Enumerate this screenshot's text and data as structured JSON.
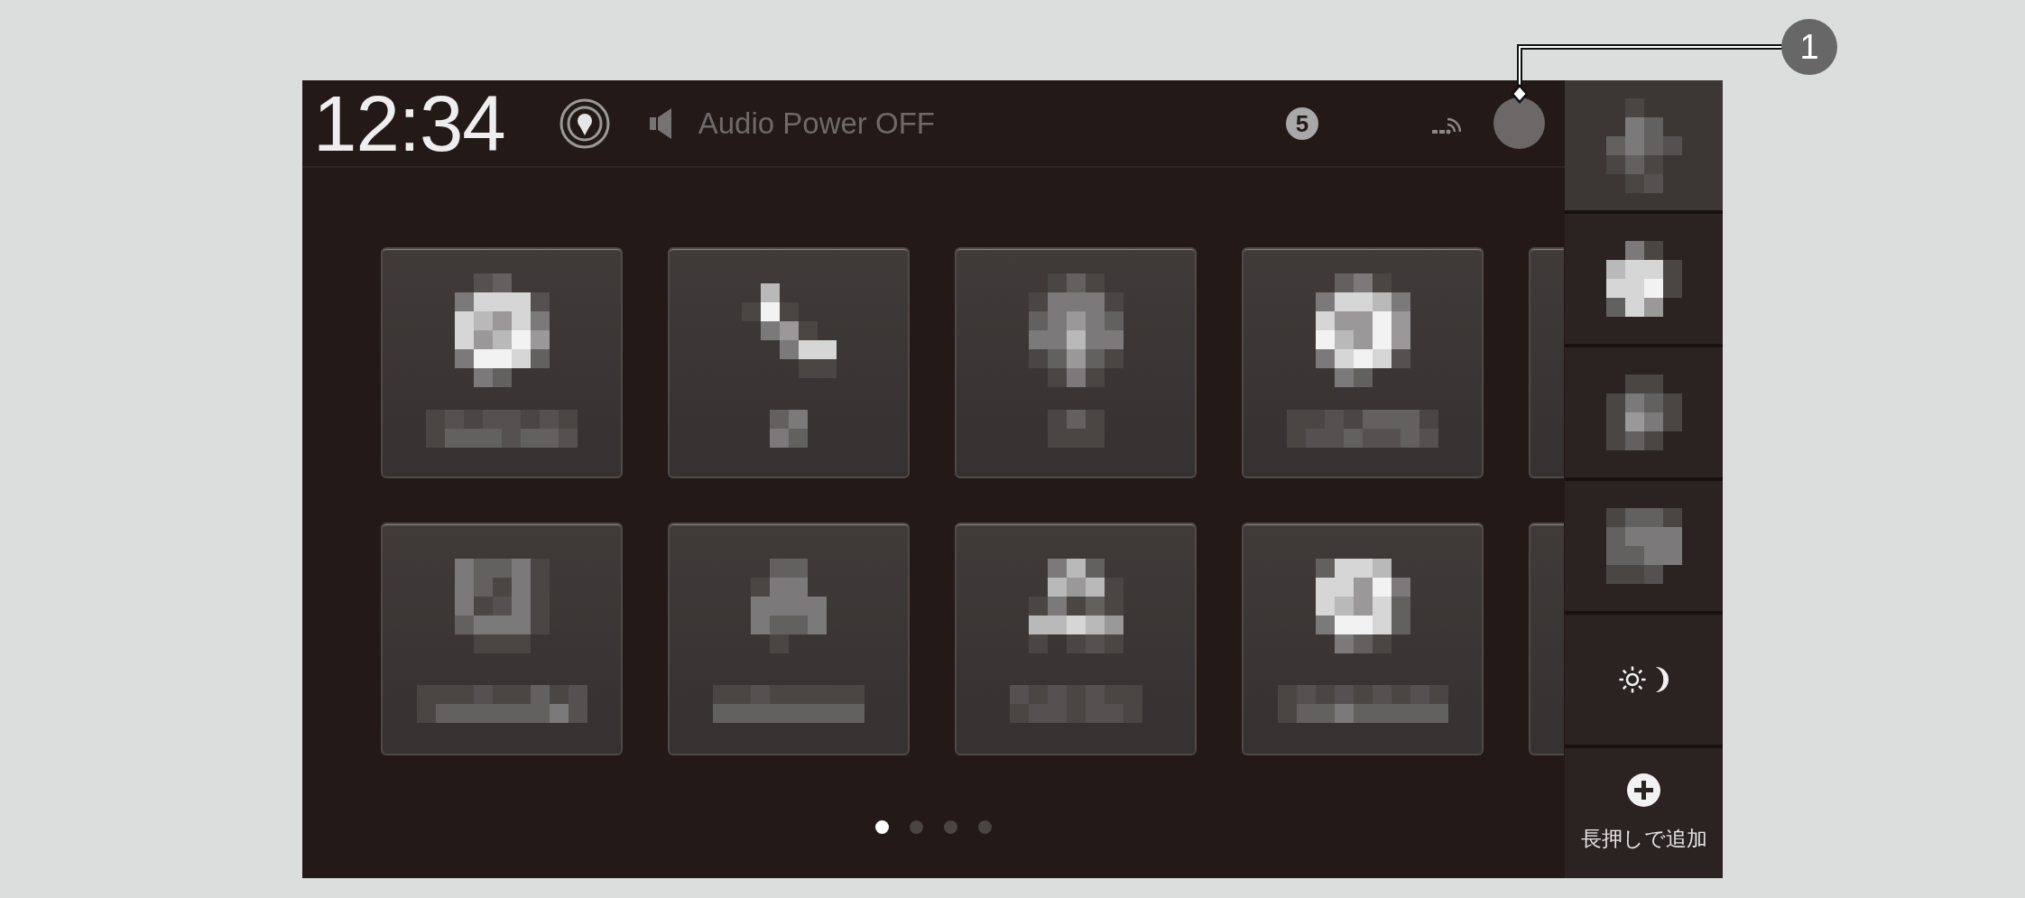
{
  "status_bar": {
    "clock": "12:34",
    "audio_status": "Audio Power OFF",
    "badge": "5"
  },
  "callout": {
    "number": "1"
  },
  "tiles": [
    {
      "kind": "disc"
    },
    {
      "kind": "handset"
    },
    {
      "kind": "pin"
    },
    {
      "kind": "ring"
    },
    {
      "kind": "partial"
    },
    {
      "kind": "square"
    },
    {
      "kind": "triangle"
    },
    {
      "kind": "nodes"
    },
    {
      "kind": "sphere"
    },
    {
      "kind": "partial"
    }
  ],
  "pages": [
    {
      "selected": true
    },
    {
      "selected": false
    },
    {
      "selected": false
    },
    {
      "selected": false
    }
  ],
  "sidebar": {
    "items": [
      {
        "kind": "mosaic_cross",
        "selected": true
      },
      {
        "kind": "mosaic_bright",
        "selected": false
      },
      {
        "kind": "mosaic_pin",
        "selected": false
      },
      {
        "kind": "mosaic_square",
        "selected": false
      },
      {
        "kind": "day_night",
        "selected": false
      },
      {
        "kind": "add",
        "label": "長押しで追加",
        "selected": false
      }
    ]
  }
}
